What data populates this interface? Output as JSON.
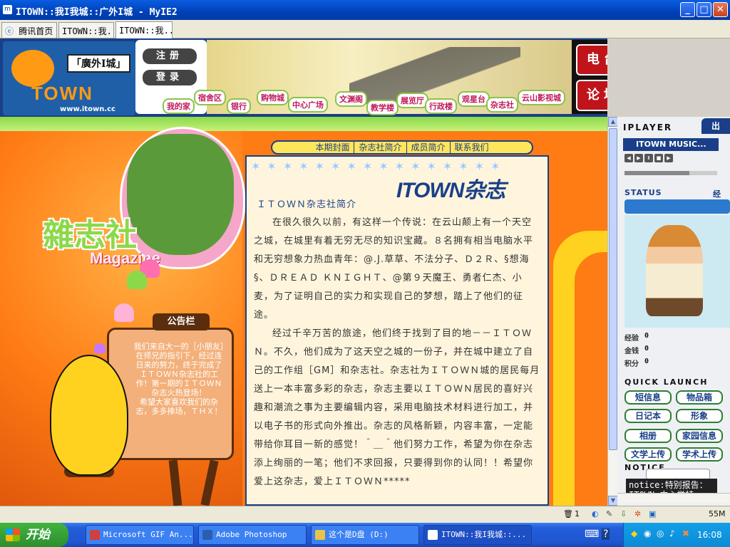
{
  "window": {
    "title": "ITOWN::我I我城::广外I城 - MyIE2",
    "buttons": {
      "minimize": "_",
      "maximize": "□",
      "close": "✕"
    }
  },
  "tabs": [
    {
      "label": "腾讯首页",
      "active": false
    },
    {
      "label": "ITOWN::我...",
      "active": false
    },
    {
      "label": "ITOWN::我...",
      "active": true
    }
  ],
  "header": {
    "logo_text": "「廣外I城」",
    "logo_brand": "TOWN",
    "url": "www.itown.cc",
    "register": "注册",
    "login": "登录",
    "nav": [
      "我的家",
      "宿舍区",
      "银行",
      "购物城",
      "中心广场",
      "文渊阁",
      "教学楼",
      "展览厅",
      "行政楼",
      "观星台",
      "杂志社",
      "云山影视城"
    ],
    "radio": "电台",
    "forum": "论坛"
  },
  "left": {
    "title_cn": "雜志社",
    "title_en": "Magazine",
    "notice_title": "公告栏",
    "notice_text_1": "我们来自大一的［小朋友］在师兄的指引下，经过连日来的努力，终于完成了ＩＴＯＷＮ杂志社的工作！第一期的ＩＴＯＷＮ杂志火热登场！",
    "notice_text_2": "希望大家喜欢我们的杂志，多多捧场，ＴＨＸ！"
  },
  "content": {
    "topnav": [
      "本期封面",
      "杂志社简介",
      "成员简介",
      "联系我们"
    ],
    "stars": "✶✶✶✶✶✶✶✶✶✶✶✶✶✶✶✶",
    "logo": "ITOWN杂志",
    "heading": "ＩＴＯＷＮ杂志社简介",
    "para1": "在很久很久以前，有这样一个传说：在云山颠上有一个天空之城，在城里有着无穷无尽的知识宝藏。８名拥有相当电脑水平和无穷想象力热血青年：@.J.草草、不法分子、Ｄ２Ｒ、§想海§、ＤＲＥＡＤ ＫＮＩＧＨＴ、@第９天魔王、勇者仁杰、小麦，为了证明自己的实力和实现自己的梦想，踏上了他们的征途。",
    "para2": "经过千辛万苦的旅途，他们终于找到了目的地－－ＩＴＯＷＮ。不久，他们成为了这天空之城的一份子，并在城中建立了自己的工作组［GM］和杂志社。杂志社为ＩＴＯＷＮ城的居民每月送上一本丰富多彩的杂志，杂志主要以ＩＴＯＷＮ居民的喜好兴趣和潮流之事为主要编辑内容，采用电脑技术材料进行加工，并以电子书的形式向外推出。杂志的风格新颖，内容丰富，一定能带给你耳目一新的感觉！＾＿＾他们努力工作，希望为你在杂志添上绚丽的一笔；他们不求回报，只要得到你的认同！！希望你爱上这杂志，爱上ＩＴＯＷＮ*****"
  },
  "widget": {
    "player_label": "IPLAYER",
    "chu": "出",
    "music": "ITOWN MUSIC...",
    "status_label": "STATUS",
    "status_val": "经",
    "stats": [
      {
        "label": "经验",
        "value": "0"
      },
      {
        "label": "金钱",
        "value": "0"
      },
      {
        "label": "积分",
        "value": "0"
      }
    ],
    "quick_launch": "QUICK LAUNCH",
    "quick": [
      "短信息",
      "物品箱",
      "日记本",
      "形象",
      "相册",
      "家园信息",
      "文学上传",
      "学术上传"
    ],
    "notice_label": "NOTICE",
    "ticker": "notice:特别报告：ITOWN 中心举特"
  },
  "statusbar": {
    "count": "1",
    "size": "55M"
  },
  "taskbar": {
    "start": "开始",
    "tasks": [
      {
        "label": "Microsoft GIF An...",
        "active": false,
        "color": "#d04040"
      },
      {
        "label": "Adobe Photoshop",
        "active": false,
        "color": "#2a5fb0"
      },
      {
        "label": "这个是D盘 (D:)",
        "active": false,
        "color": "#e9c34a"
      },
      {
        "label": "ITOWN::我I我城::...",
        "active": true,
        "color": "#ffffff"
      }
    ],
    "clock": "16:08"
  }
}
